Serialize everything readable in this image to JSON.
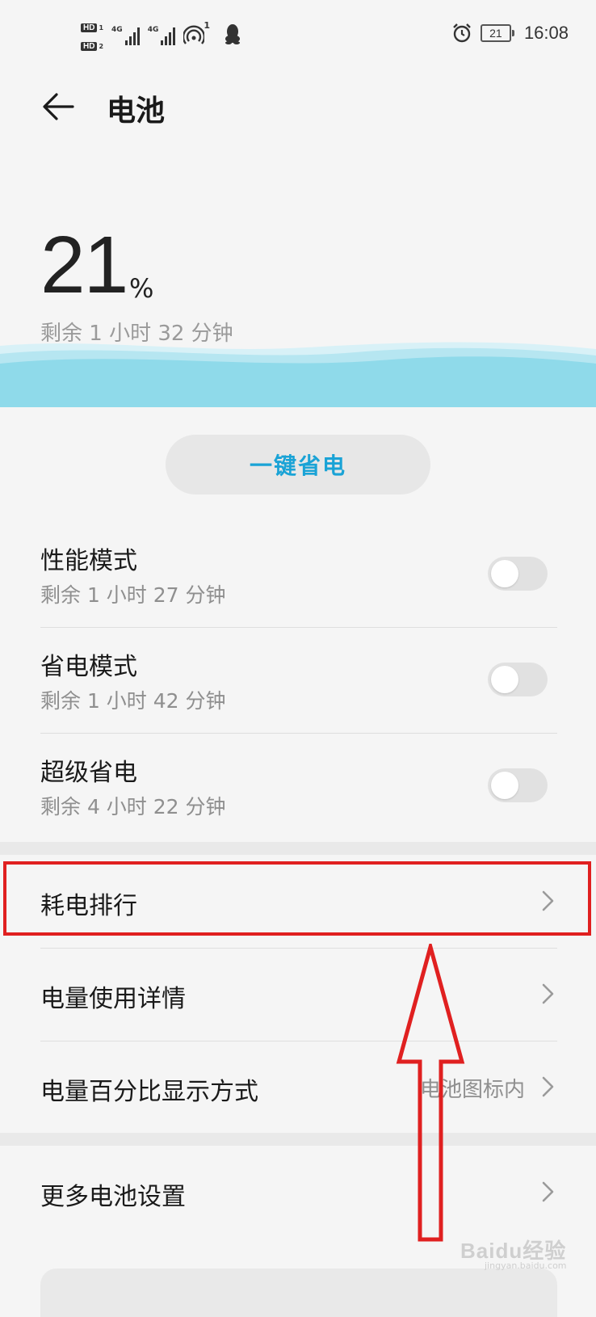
{
  "status_bar": {
    "hd1": "HD",
    "hd1_sub": "1",
    "hd2": "HD",
    "hd2_sub": "2",
    "net1": "4G",
    "net2": "4G",
    "hotspot_count": "1",
    "battery_level": "21",
    "time": "16:08"
  },
  "header": {
    "title": "电池"
  },
  "battery": {
    "percent": "21",
    "percent_symbol": "%",
    "remaining": "剩余 1 小时 32 分钟"
  },
  "one_key_save": {
    "label": "一键省电"
  },
  "modes": [
    {
      "title": "性能模式",
      "subtitle": "剩余 1 小时 27 分钟",
      "enabled": false
    },
    {
      "title": "省电模式",
      "subtitle": "剩余 1 小时 42 分钟",
      "enabled": false
    },
    {
      "title": "超级省电",
      "subtitle": "剩余 4 小时 22 分钟",
      "enabled": false
    }
  ],
  "list": {
    "power_ranking": "耗电排行",
    "usage_details": "电量使用详情",
    "percent_display": "电量百分比显示方式",
    "percent_display_value": "电池图标内",
    "more_settings": "更多电池设置"
  },
  "watermark": {
    "text": "Baidu经验",
    "sub": "jingyan.baidu.com"
  },
  "colors": {
    "accent": "#1aa3d6",
    "annotation": "#e02020",
    "wave": "#8fdaea"
  }
}
